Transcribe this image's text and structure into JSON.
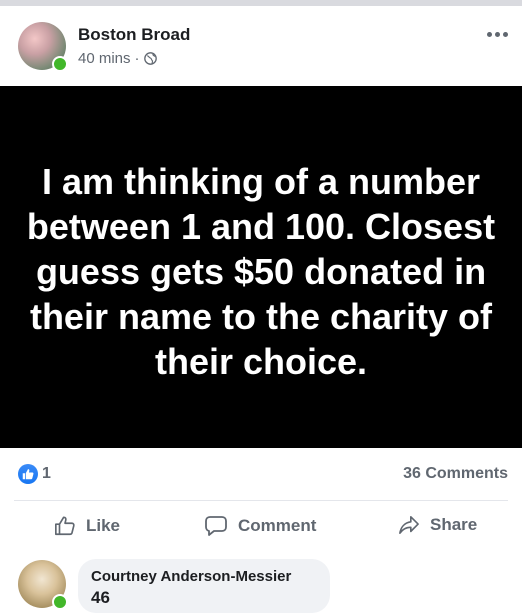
{
  "post": {
    "author": "Boston Broad",
    "time": "40 mins",
    "separator": "·",
    "privacy_icon": "globe-icon",
    "more_icon": "ellipsis-icon",
    "text": "I am thinking of a number between 1 and 100. Closest guess gets $50 donated in their name to the charity of their choice."
  },
  "stats": {
    "reaction_icon": "like-reaction-icon",
    "reactions_count": "1",
    "comments_count": "36 Comments"
  },
  "actions": {
    "like": "Like",
    "comment": "Comment",
    "share": "Share"
  },
  "comment": {
    "author": "Courtney Anderson-Messier",
    "text": "46"
  },
  "colors": {
    "accent": "#1877f2",
    "online": "#42b72a",
    "secondary_text": "#606770",
    "bubble": "#f0f2f5"
  }
}
